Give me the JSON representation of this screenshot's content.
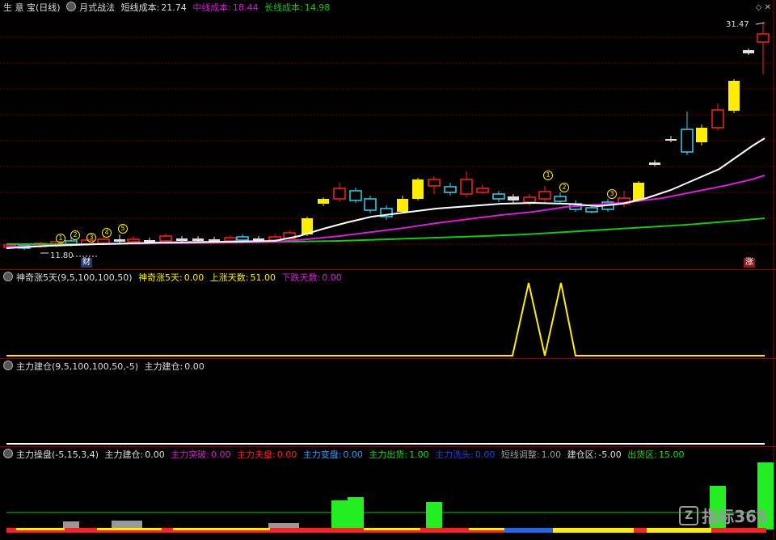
{
  "panel1": {
    "stock_name": "生 意 宝",
    "period": "(日线)",
    "indicator": "月式战法",
    "short_label": "短线成本:",
    "short_value": "21.74",
    "mid_label": "中线成本:",
    "mid_value": "18.44",
    "long_label": "长线成本:",
    "long_value": "14.98",
    "high_label": "31.47",
    "low_label": "11.80",
    "cai_badge": "财",
    "zhang_badge": "涨",
    "circles": [
      "1",
      "2",
      "3",
      "4",
      "5",
      "1",
      "2",
      "3"
    ]
  },
  "panel2": {
    "title": "神奇涨5天(9,5,100,100,50)",
    "l1": "神奇涨5天:",
    "v1": "0.00",
    "l2": "上涨天数:",
    "v2": "51.00",
    "l3": "下跌天数:",
    "v3": "0.00"
  },
  "panel3": {
    "title": "主力建仓(9,5,100,100,50,-5)",
    "l1": "主力建仓:",
    "v1": "0.00"
  },
  "panel4": {
    "title": "主力操盘(-5,15,3,4)",
    "l1": "主力建仓:",
    "v1": "0.00",
    "l2": "主力突破:",
    "v2": "0.00",
    "l3": "主力夫盘:",
    "v3": "0.00",
    "l4": "主力变盘:",
    "v4": "0.00",
    "l5": "主力出货:",
    "v5": "1.00",
    "l6": "主力洗头:",
    "v6": "0.00",
    "l7": "短线调整:",
    "v7": "1.00",
    "l8": "建仓区:",
    "v8": "-5.00",
    "l9": "出货区:",
    "v9": "15.00"
  },
  "watermark": "指标365",
  "colors": {
    "white_line": "#ffffff",
    "magenta_line": "#d51fd5",
    "green_line": "#19c619",
    "yellow": "#ffee00",
    "red": "#ff2020",
    "cyan": "#32d2f0"
  }
}
